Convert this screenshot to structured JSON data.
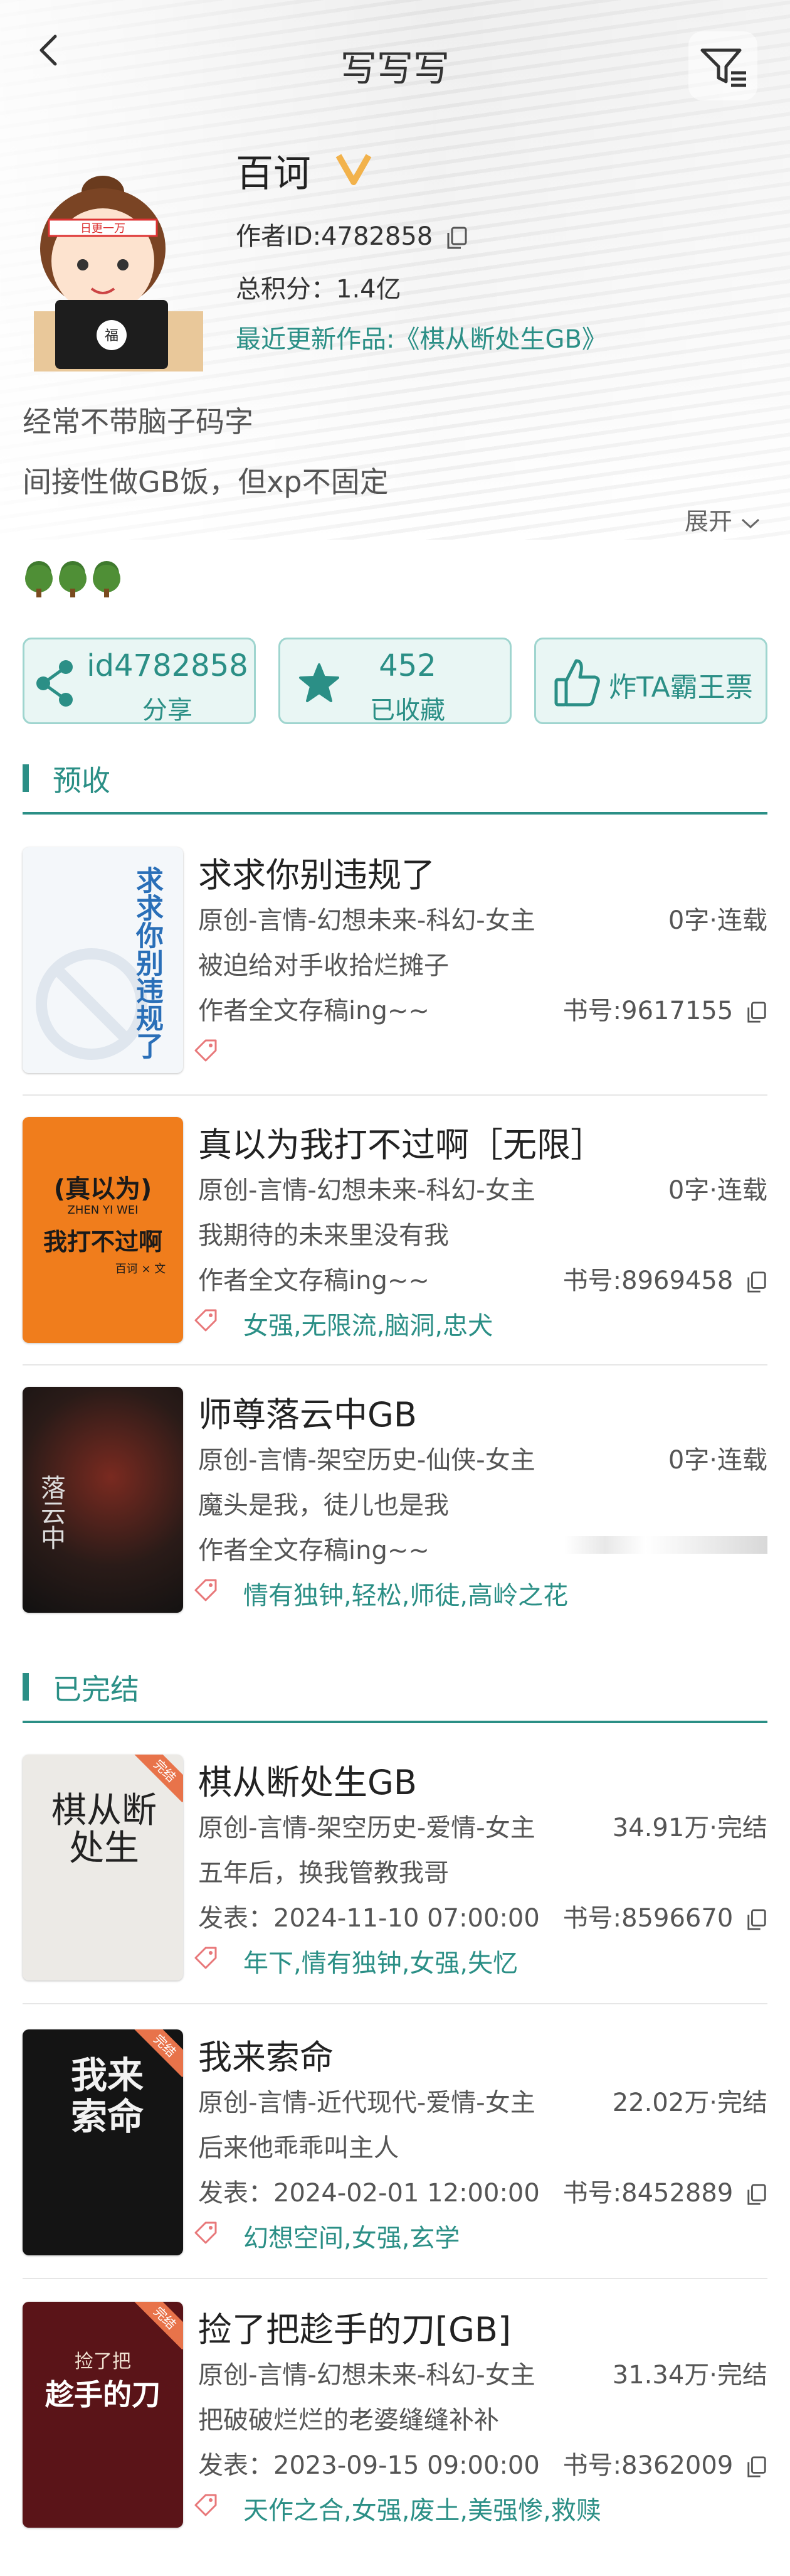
{
  "header": {
    "title": "写写写"
  },
  "profile": {
    "name": "百诃",
    "author_id_text": "作者ID:4782858",
    "total_points_text": "总积分：1.4亿",
    "latest_update_text": "最近更新作品:《棋从断处生GB》",
    "bio_lines": [
      "经常不带脑子码字",
      "间接性做GB饭，但xp不固定"
    ],
    "expand_label": "展开"
  },
  "actions": {
    "share": {
      "title": "id4782858",
      "sub": "分享"
    },
    "collect": {
      "title": "452",
      "sub": "已收藏"
    },
    "vote": {
      "title": "炸TA霸王票"
    }
  },
  "sections": {
    "presale": "预收",
    "completed": "已完结"
  },
  "books": [
    {
      "title": "求求你别违规了",
      "genre": "原创-言情-幻想未来-科幻-女主",
      "status": "0字·连载",
      "desc": "被迫给对手收拾烂摊子",
      "line3": "作者全文存稿ing~~",
      "number": "书号:9617155",
      "tags": "",
      "cover_text": "求求你别违规了"
    },
    {
      "title": "真以为我打不过啊［无限］",
      "genre": "原创-言情-幻想未来-科幻-女主",
      "status": "0字·连载",
      "desc": "我期待的未来里没有我",
      "line3": "作者全文存稿ing~~",
      "number": "书号:8969458",
      "tags": "女强,无限流,脑洞,忠犬",
      "cover_text_a": "(真以为)",
      "cover_text_b": "我打不过啊",
      "cover_pinyin": "ZHEN YI WEI",
      "cover_author": "百诃 × 文"
    },
    {
      "title": "师尊落云中GB",
      "genre": "原创-言情-架空历史-仙侠-女主",
      "status": "0字·连载",
      "desc": "魔头是我，徒儿也是我",
      "line3": "作者全文存稿ing~~",
      "number": "",
      "tags": "情有独钟,轻松,师徒,高岭之花",
      "cover_text": "落云中"
    },
    {
      "title": "棋从断处生GB",
      "genre": "原创-言情-架空历史-爱情-女主",
      "status": "34.91万·完结",
      "desc": "五年后，换我管教我哥",
      "line3": "发表：2024-11-10 07:00:00",
      "number": "书号:8596670",
      "tags": "年下,情有独钟,女强,失忆",
      "cover_text": "棋从断处生",
      "badge": "完结"
    },
    {
      "title": "我来索命",
      "genre": "原创-言情-近代现代-爱情-女主",
      "status": "22.02万·完结",
      "desc": "后来他乖乖叫主人",
      "line3": "发表：2024-02-01 12:00:00",
      "number": "书号:8452889",
      "tags": "幻想空间,女强,玄学",
      "cover_text": "我来索命",
      "badge": "完结"
    },
    {
      "title": "捡了把趁手的刀[GB]",
      "genre": "原创-言情-幻想未来-科幻-女主",
      "status": "31.34万·完结",
      "desc": "把破破烂烂的老婆缝缝补补",
      "line3": "发表：2023-09-15 09:00:00",
      "number": "书号:8362009",
      "tags": "天作之合,女强,废土,美强惨,救赎",
      "cover_text_a": "捡了把",
      "cover_text_b": "趁手的刀",
      "badge": "完结"
    }
  ],
  "colors": {
    "accent": "#2b8f86",
    "vip": "#f2b24b",
    "tag_icon": "#e8787a"
  }
}
